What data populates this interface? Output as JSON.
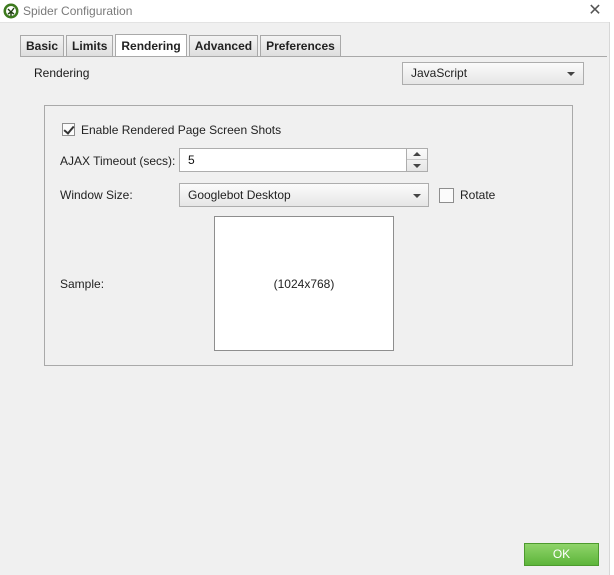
{
  "window": {
    "title": "Spider Configuration",
    "app_icon": "spider-logo-icon",
    "close_icon": "close-icon",
    "close_glyph": "✕"
  },
  "tabs": [
    {
      "label": "Basic",
      "active": false
    },
    {
      "label": "Limits",
      "active": false
    },
    {
      "label": "Rendering",
      "active": true
    },
    {
      "label": "Advanced",
      "active": false
    },
    {
      "label": "Preferences",
      "active": false
    }
  ],
  "rendering": {
    "label": "Rendering",
    "mode_value": "JavaScript"
  },
  "options": {
    "screenshots_label": "Enable Rendered Page Screen Shots",
    "screenshots_checked": true,
    "ajax_timeout_label": "AJAX Timeout (secs):",
    "ajax_timeout_value": "5",
    "window_size_label": "Window Size:",
    "window_size_value": "Googlebot Desktop",
    "rotate_label": "Rotate",
    "rotate_checked": false,
    "sample_label": "Sample:",
    "sample_value": "(1024x768)"
  },
  "footer": {
    "ok_label": "OK"
  },
  "colors": {
    "ok_button": "#5db53a",
    "app_icon_green": "#3d7a1e",
    "background": "#f0f0f0"
  }
}
